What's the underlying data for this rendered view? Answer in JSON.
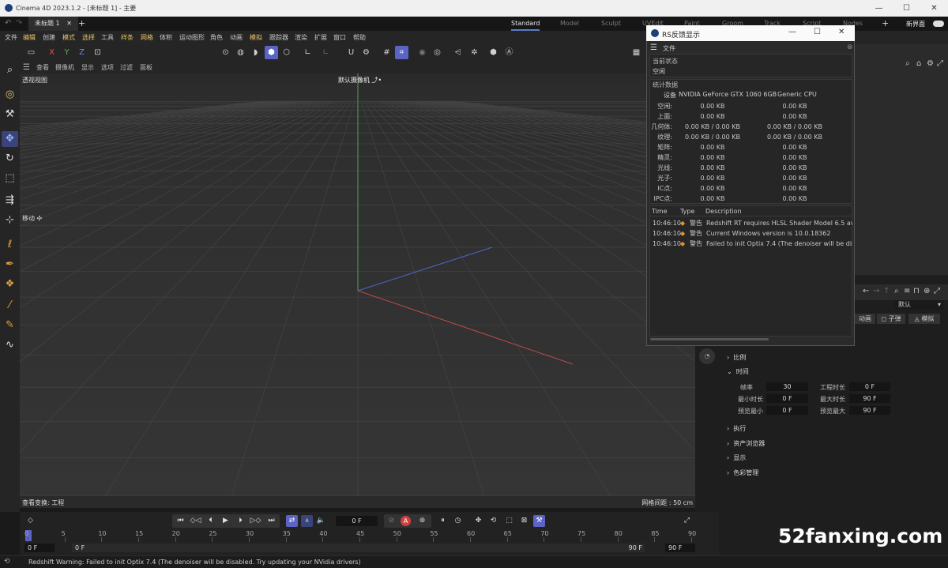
{
  "window": {
    "title": "Cinema 4D 2023.1.2 - [未标题 1] - 主要",
    "min": "—",
    "max": "☐",
    "close": "✕"
  },
  "tabs": {
    "document": "未标题 1",
    "add": "+",
    "layouts": [
      "Standard",
      "Model",
      "Sculpt",
      "UVEdit",
      "Paint",
      "Groom",
      "Track",
      "Script",
      "Nodes"
    ],
    "active_layout": "Standard",
    "new_ui": "新界面"
  },
  "menu": [
    "文件",
    "编辑",
    "创建",
    "模式",
    "选择",
    "工具",
    "样条",
    "网格",
    "体积",
    "运动图形",
    "角色",
    "动画",
    "模拟",
    "跟踪器",
    "渲染",
    "扩展",
    "窗口",
    "帮助"
  ],
  "viewport_menu": [
    "查看",
    "摄像机",
    "显示",
    "选项",
    "过滤",
    "面板"
  ],
  "viewport": {
    "name": "透视视图",
    "camera": "默认摄像机",
    "move_label": "移动",
    "view_transform": "查看变换: 工程",
    "grid_spacing": "网格间距 : 50 cm",
    "axis_colors": {
      "x": "#c24848",
      "y": "#4ca44c",
      "z": "#4a67c6"
    }
  },
  "toolbar": {
    "x": "X",
    "y": "Y",
    "z": "Z"
  },
  "rs_window": {
    "title": "RS反馈显示",
    "file_menu": "文件",
    "current_status_label": "当前状态",
    "current_status_value": "空闲",
    "stats_label": "统计数据",
    "device_label": "设备",
    "gpu": "NVIDIA GeForce GTX 1060 6GB",
    "cpu": "Generic CPU",
    "rows": [
      {
        "name": "空闲:",
        "gpu": "0.00 KB",
        "cpu": "0.00 KB"
      },
      {
        "name": "上面:",
        "gpu": "0.00 KB",
        "cpu": "0.00 KB"
      },
      {
        "name": "几何体:",
        "gpu": "0.00 KB / 0.00 KB",
        "cpu": "0.00 KB / 0.00 KB"
      },
      {
        "name": "纹理:",
        "gpu": "0.00 KB / 0.00 KB",
        "cpu": "0.00 KB / 0.00 KB"
      },
      {
        "name": "矩阵:",
        "gpu": "0.00 KB",
        "cpu": "0.00 KB"
      },
      {
        "name": "精灵:",
        "gpu": "0.00 KB",
        "cpu": "0.00 KB"
      },
      {
        "name": "光线:",
        "gpu": "0.00 KB",
        "cpu": "0.00 KB"
      },
      {
        "name": "光子:",
        "gpu": "0.00 KB",
        "cpu": "0.00 KB"
      },
      {
        "name": "IC点:",
        "gpu": "0.00 KB",
        "cpu": "0.00 KB"
      },
      {
        "name": "IPC点:",
        "gpu": "0.00 KB",
        "cpu": "0.00 KB"
      }
    ],
    "log_headers": [
      "Time",
      "Type",
      "Description"
    ],
    "log": [
      {
        "time": "10:46:10",
        "type": "警告",
        "desc": "Redshift RT requires HLSL Shader Model 6.5 availal"
      },
      {
        "time": "10:46:10",
        "type": "警告",
        "desc": "Current Windows version is 10.0.18362"
      },
      {
        "time": "10:46:10",
        "type": "警告",
        "desc": "Failed to init Optix 7.4 (The denoiser will be disable"
      }
    ]
  },
  "attributes": {
    "default": "默认",
    "tabs": [
      "动画",
      "子弹",
      "模拟"
    ],
    "sections": [
      "比例",
      "时间",
      "执行",
      "资产浏览器",
      "显示",
      "色彩管理"
    ],
    "time": [
      {
        "label": "帧率",
        "value": "30",
        "label2": "工程时长",
        "value2": "0 F"
      },
      {
        "label": "最小时长",
        "value": "0 F",
        "label2": "最大时长",
        "value2": "90 F"
      },
      {
        "label": "预览最小",
        "value": "0 F",
        "label2": "预览最大",
        "value2": "90 F"
      }
    ]
  },
  "timeline": {
    "current_frame": "0 F",
    "ticks": [
      "0",
      "5",
      "10",
      "15",
      "20",
      "25",
      "30",
      "35",
      "40",
      "45",
      "50",
      "55",
      "60",
      "65",
      "70",
      "75",
      "80",
      "85",
      "90"
    ],
    "start": "0 F",
    "range_start": "0 F",
    "range_end": "90 F",
    "end": "90 F"
  },
  "status": "Redshift Warning: Failed to init Optix 7.4 (The denoiser will be disabled. Try updating your NVidia drivers)",
  "watermark": "52fanxing.com"
}
